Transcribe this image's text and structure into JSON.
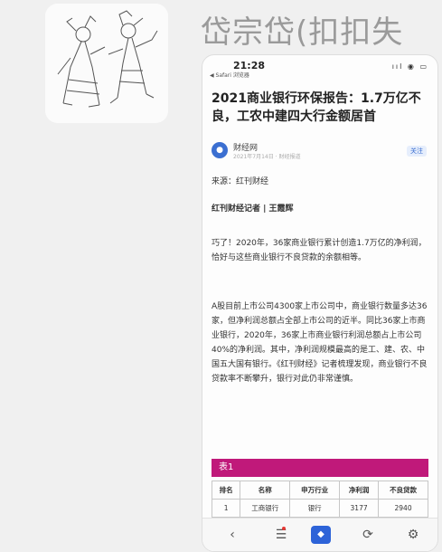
{
  "chat": {
    "sender_name": "岱宗岱(扣扣失"
  },
  "screenshot": {
    "status_bar": {
      "time": "21:28",
      "back_app": "◀ Safari 浏览器",
      "icons": "ııl ◉ ▭"
    },
    "article": {
      "title": "2021商业银行环保报告：1.7万亿不良，工农中建四大行金额居首",
      "account_name": "财经网",
      "account_meta": "2021年7月14日 · 财经报道",
      "follow_label": "关注",
      "source": "来源：红刊财经",
      "author": "红刊财经记者 | 王霞辉",
      "para1": "巧了！2020年，36家商业银行累计创造1.7万亿的净利润，恰好与这些商业银行不良贷款的余额相等。",
      "para2": "A股目前上市公司4300家上市公司中，商业银行数量多达36家，但净利润总额占全部上市公司的近半。同比36家上市商业银行，2020年，36家上市商业银行利润总额占上市公司40%的净利润。其中，净利润规模最高的是工、建、农、中国五大国有银行。《红刊财经》记者梳理发现，商业银行不良贷款率不断攀升，银行对此仍非常谨慎。",
      "table": {
        "title": "表1",
        "headers": [
          "排名",
          "名称",
          "申万行业",
          "净利润",
          "不良贷款"
        ],
        "row": [
          "1",
          "工商银行",
          "银行",
          "3177",
          "2940"
        ]
      }
    },
    "bottom_bar": {
      "back_icon": "‹",
      "list_icon": "☰",
      "center_icon": "◆",
      "share_icon": "⟳",
      "more_icon": "⚙"
    }
  }
}
